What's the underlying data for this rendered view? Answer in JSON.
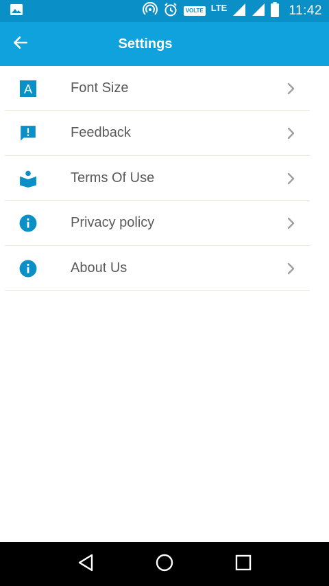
{
  "status_bar": {
    "time": "11:42",
    "volte": "VOLTE",
    "network": "LTE",
    "icons": [
      "image-notification-icon",
      "hotspot-icon",
      "alarm-icon",
      "volte-icon",
      "signal-icon",
      "signal-icon-2",
      "battery-icon"
    ]
  },
  "app_bar": {
    "title": "Settings",
    "back_icon": "arrow-left-icon"
  },
  "colors": {
    "status_bar": "#0a8fc6",
    "app_bar": "#0fa2dc",
    "accent": "#0a8fc6",
    "label_text": "#5a5a5a",
    "chevron": "#9e9e9e",
    "divider": "#ece7d6",
    "nav_bar": "#000000"
  },
  "settings": {
    "items": [
      {
        "label": "Font Size",
        "icon": "font-size-icon"
      },
      {
        "label": "Feedback",
        "icon": "feedback-icon"
      },
      {
        "label": "Terms Of Use",
        "icon": "book-reader-icon"
      },
      {
        "label": "Privacy policy",
        "icon": "info-icon"
      },
      {
        "label": "About Us",
        "icon": "info-icon"
      }
    ]
  },
  "nav_bar": {
    "buttons": [
      "back-triangle-icon",
      "home-circle-icon",
      "recents-square-icon"
    ]
  }
}
